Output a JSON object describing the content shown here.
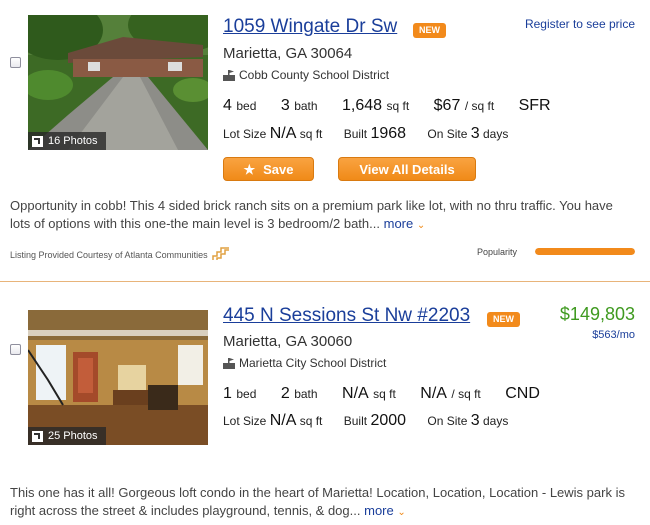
{
  "listings": [
    {
      "address": "1059 Wingate Dr Sw",
      "badge": "NEW",
      "city": "Marietta, GA 30064",
      "school": "Cobb County School District",
      "price_text": "Register to see price",
      "beds": "4",
      "beds_label": "bed",
      "baths": "3",
      "baths_label": "bath",
      "sqft": "1,648",
      "sqft_label": "sq ft",
      "price_per_sqft": "$67",
      "per_sqft_label": "/ sq ft",
      "type": "SFR",
      "lot_label": "Lot Size",
      "lot": "N/A",
      "lot_unit": "sq ft",
      "built_label": "Built",
      "built": "1968",
      "onsite_label": "On Site",
      "onsite": "3",
      "onsite_unit": "days",
      "photos": "16 Photos",
      "save_label": "Save",
      "details_label": "View All Details",
      "description": "Opportunity in cobb! This 4 sided brick ranch sits on a premium park like lot, with no thru traffic. You have lots of options with this one-the main level is 3 bedroom/2 bath...",
      "more_label": "more",
      "courtesy": "Listing Provided Courtesy of Atlanta Communities",
      "popularity_label": "Popularity",
      "popularity": 1.0
    },
    {
      "address": "445 N Sessions St Nw #2203",
      "badge": "NEW",
      "city": "Marietta, GA 30060",
      "school": "Marietta City School District",
      "price": "$149,803",
      "per_month": "$563/mo",
      "beds": "1",
      "beds_label": "bed",
      "baths": "2",
      "baths_label": "bath",
      "sqft": "N/A",
      "sqft_label": "sq ft",
      "price_per_sqft": "N/A",
      "per_sqft_label": "/ sq ft",
      "type": "CND",
      "lot_label": "Lot Size",
      "lot": "N/A",
      "lot_unit": "sq ft",
      "built_label": "Built",
      "built": "2000",
      "onsite_label": "On Site",
      "onsite": "3",
      "onsite_unit": "days",
      "photos": "25 Photos",
      "description": "This one has it all! Gorgeous loft condo in the heart of Marietta! Location, Location, Location - Lewis park is right across the street & includes playground, tennis, & dog...",
      "more_label": "more"
    }
  ],
  "colors": {
    "accent": "#f28a1b",
    "link": "#1a3e9a",
    "price": "#3f9a20"
  }
}
